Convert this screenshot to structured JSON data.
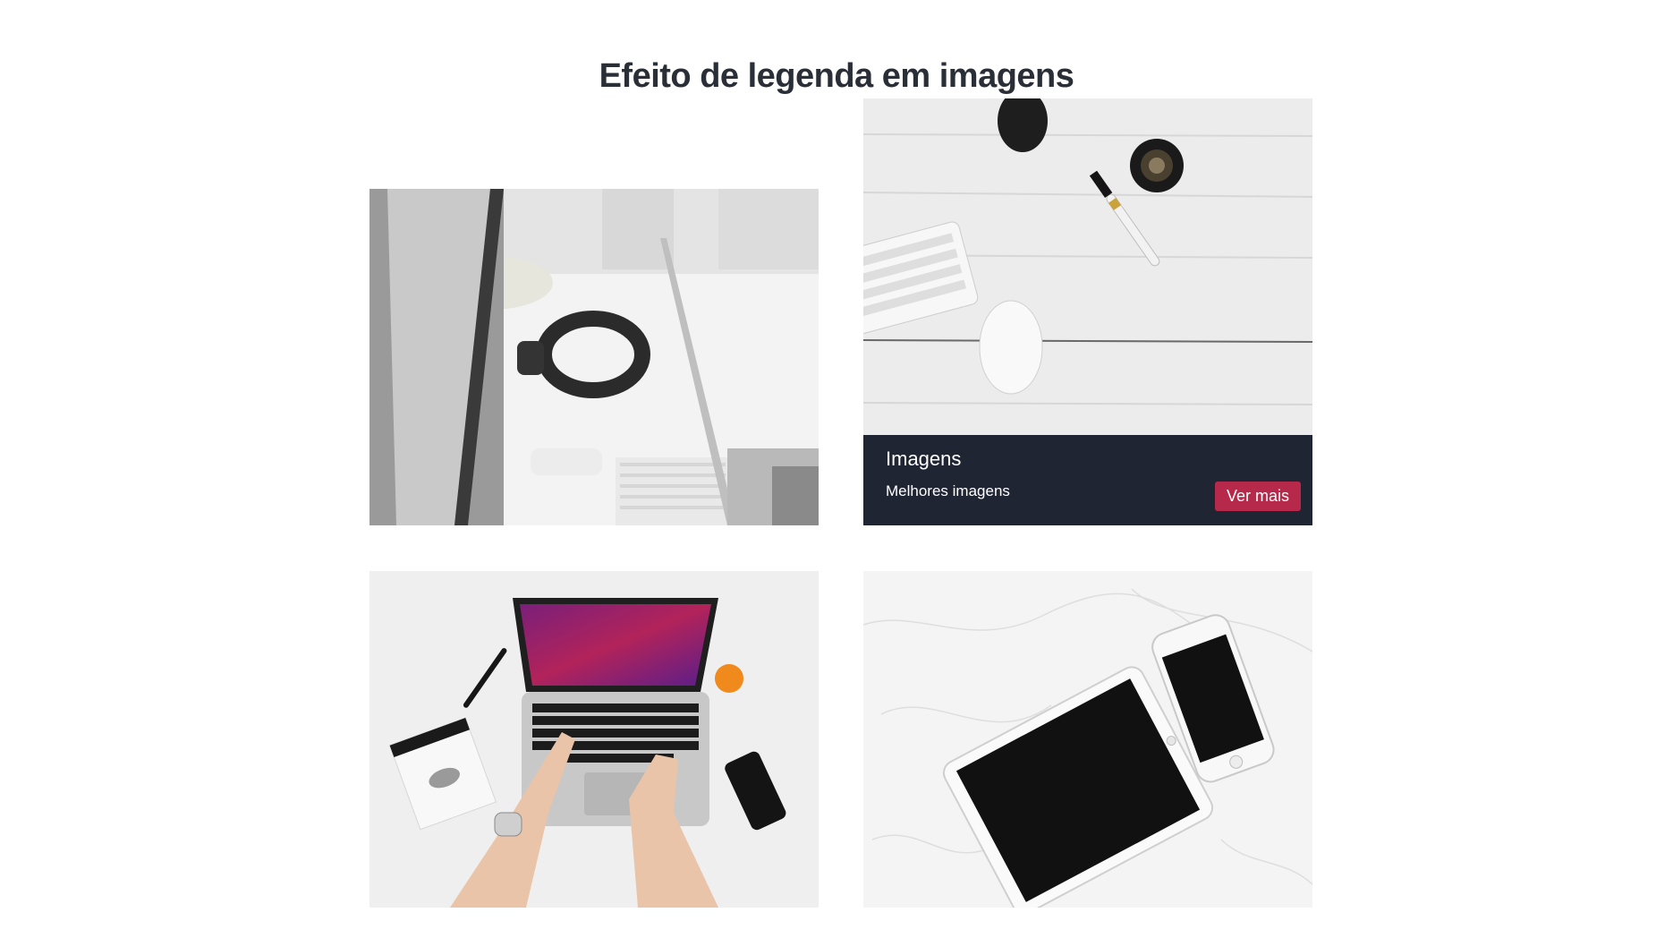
{
  "page": {
    "title": "Efeito de legenda em imagens"
  },
  "gallery": {
    "cards": [
      {
        "image": "desk-with-headphones-photo",
        "hovered": false
      },
      {
        "image": "white-wood-desk-with-keyboard-mouse-lens-photo",
        "hovered": true,
        "caption": {
          "title": "Imagens",
          "subtitle": "Melhores imagens",
          "button_label": "Ver mais"
        }
      },
      {
        "image": "hands-typing-on-laptop-photo",
        "hovered": false
      },
      {
        "image": "tablet-and-phone-on-marble-photo",
        "hovered": false
      }
    ]
  },
  "colors": {
    "caption_background": "#202534",
    "button_background": "#b6294a",
    "title_text": "#2a2f37"
  }
}
